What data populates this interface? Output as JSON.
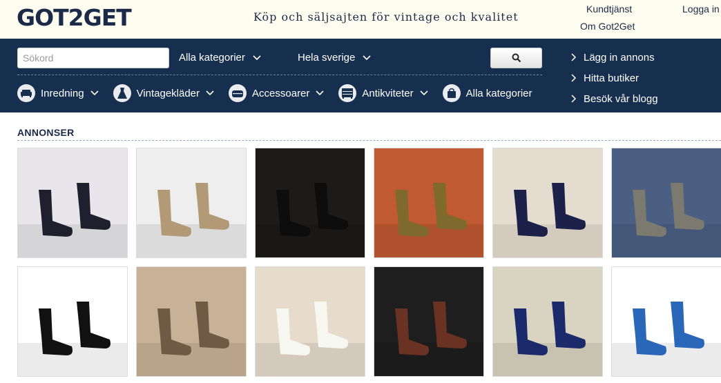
{
  "header": {
    "logo": "GOT2GET",
    "tagline": "Köp och säljsajten för vintage och kvalitet",
    "links": {
      "kundtjanst": "Kundtjänst",
      "om": "Om Got2Get",
      "logga_in": "Logga in"
    }
  },
  "search": {
    "placeholder": "Sökord",
    "category_dropdown": "Alla kategorier",
    "region_dropdown": "Hela sverige",
    "button_icon": "search-icon"
  },
  "categories": [
    {
      "label": "Inredning",
      "icon": "sofa-icon",
      "has_dropdown": true
    },
    {
      "label": "Vintagekläder",
      "icon": "dress-icon",
      "has_dropdown": true
    },
    {
      "label": "Accessoarer",
      "icon": "bag-icon",
      "has_dropdown": true
    },
    {
      "label": "Antikviteter",
      "icon": "dresser-icon",
      "has_dropdown": true
    },
    {
      "label": "Alla kategorier",
      "icon": "shopping-bag-icon",
      "has_dropdown": false
    }
  ],
  "side_links": [
    "Lägg in annons",
    "Hitta butiker",
    "Besök vår blogg"
  ],
  "listings": {
    "title": "ANNONSER",
    "items": [
      {
        "description": "black stiletto pumps",
        "bg": "#e8e6ea",
        "shoe": "#1f1f2e"
      },
      {
        "description": "tan lace-up boots",
        "bg": "#eeeeee",
        "shoe": "#b39a77"
      },
      {
        "description": "black leather ankle boots",
        "bg": "#1d1a1a",
        "shoe": "#0d0d0d"
      },
      {
        "description": "olive leather lace-up shoes",
        "bg": "#c05a33",
        "shoe": "#7e6a2c"
      },
      {
        "description": "navy ruffled pumps",
        "bg": "#e4ddcf",
        "shoe": "#1b2148"
      },
      {
        "description": "metallic grey pumps",
        "bg": "#4b5f83",
        "shoe": "#7c7a6e"
      },
      {
        "description": "black wedge ankle boots",
        "bg": "#ffffff",
        "shoe": "#111111"
      },
      {
        "description": "brown slouch ankle boots",
        "bg": "#c9b197",
        "shoe": "#6f5a45"
      },
      {
        "description": "white t-strap heels",
        "bg": "#e7dccc",
        "shoe": "#f7f7f2"
      },
      {
        "description": "monogram sneakers",
        "bg": "#1e1e1e",
        "shoe": "#6a3222"
      },
      {
        "description": "navy embroidered pumps",
        "bg": "#d9d3c1",
        "shoe": "#1b2a6a"
      },
      {
        "description": "blue chelsea boots",
        "bg": "#ffffff",
        "shoe": "#2a67b8"
      }
    ]
  }
}
